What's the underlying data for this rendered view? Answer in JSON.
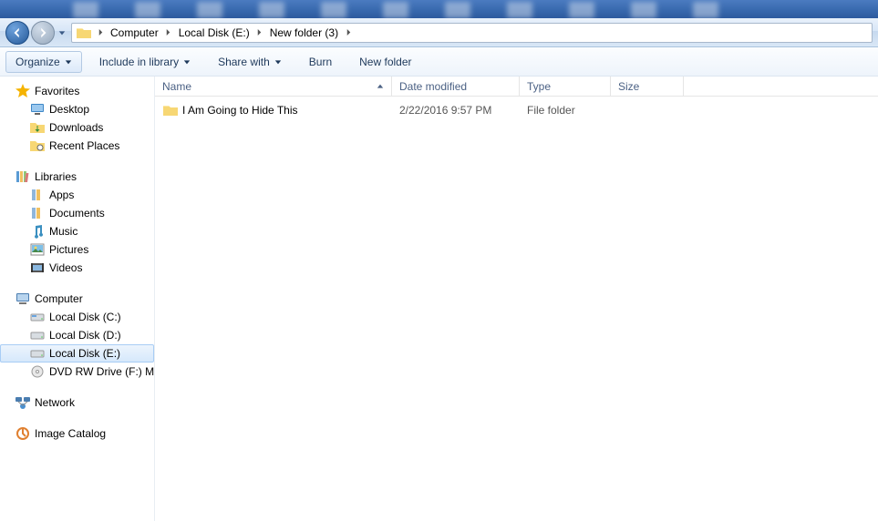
{
  "breadcrumb": {
    "items": [
      "Computer",
      "Local Disk (E:)",
      "New folder (3)"
    ]
  },
  "toolbar": {
    "organize": "Organize",
    "include": "Include in library",
    "share": "Share with",
    "burn": "Burn",
    "newfolder": "New folder"
  },
  "sidebar": {
    "favorites": {
      "label": "Favorites",
      "items": [
        {
          "label": "Desktop",
          "icon": "desktop"
        },
        {
          "label": "Downloads",
          "icon": "downloads"
        },
        {
          "label": "Recent Places",
          "icon": "recent"
        }
      ]
    },
    "libraries": {
      "label": "Libraries",
      "items": [
        {
          "label": "Apps",
          "icon": "lib"
        },
        {
          "label": "Documents",
          "icon": "lib"
        },
        {
          "label": "Music",
          "icon": "music"
        },
        {
          "label": "Pictures",
          "icon": "pictures"
        },
        {
          "label": "Videos",
          "icon": "videos"
        }
      ]
    },
    "computer": {
      "label": "Computer",
      "items": [
        {
          "label": "Local Disk (C:)",
          "icon": "drive",
          "selected": false
        },
        {
          "label": "Local Disk (D:)",
          "icon": "drive",
          "selected": false
        },
        {
          "label": "Local Disk (E:)",
          "icon": "drive",
          "selected": true
        },
        {
          "label": "DVD RW Drive (F:)  M",
          "icon": "dvd",
          "selected": false
        }
      ]
    },
    "network": {
      "label": "Network"
    },
    "imagecatalog": {
      "label": "Image Catalog"
    }
  },
  "columns": {
    "name": "Name",
    "date": "Date modified",
    "type": "Type",
    "size": "Size"
  },
  "files": [
    {
      "name": "I Am Going to Hide This",
      "date": "2/22/2016 9:57 PM",
      "type": "File folder",
      "size": ""
    }
  ]
}
